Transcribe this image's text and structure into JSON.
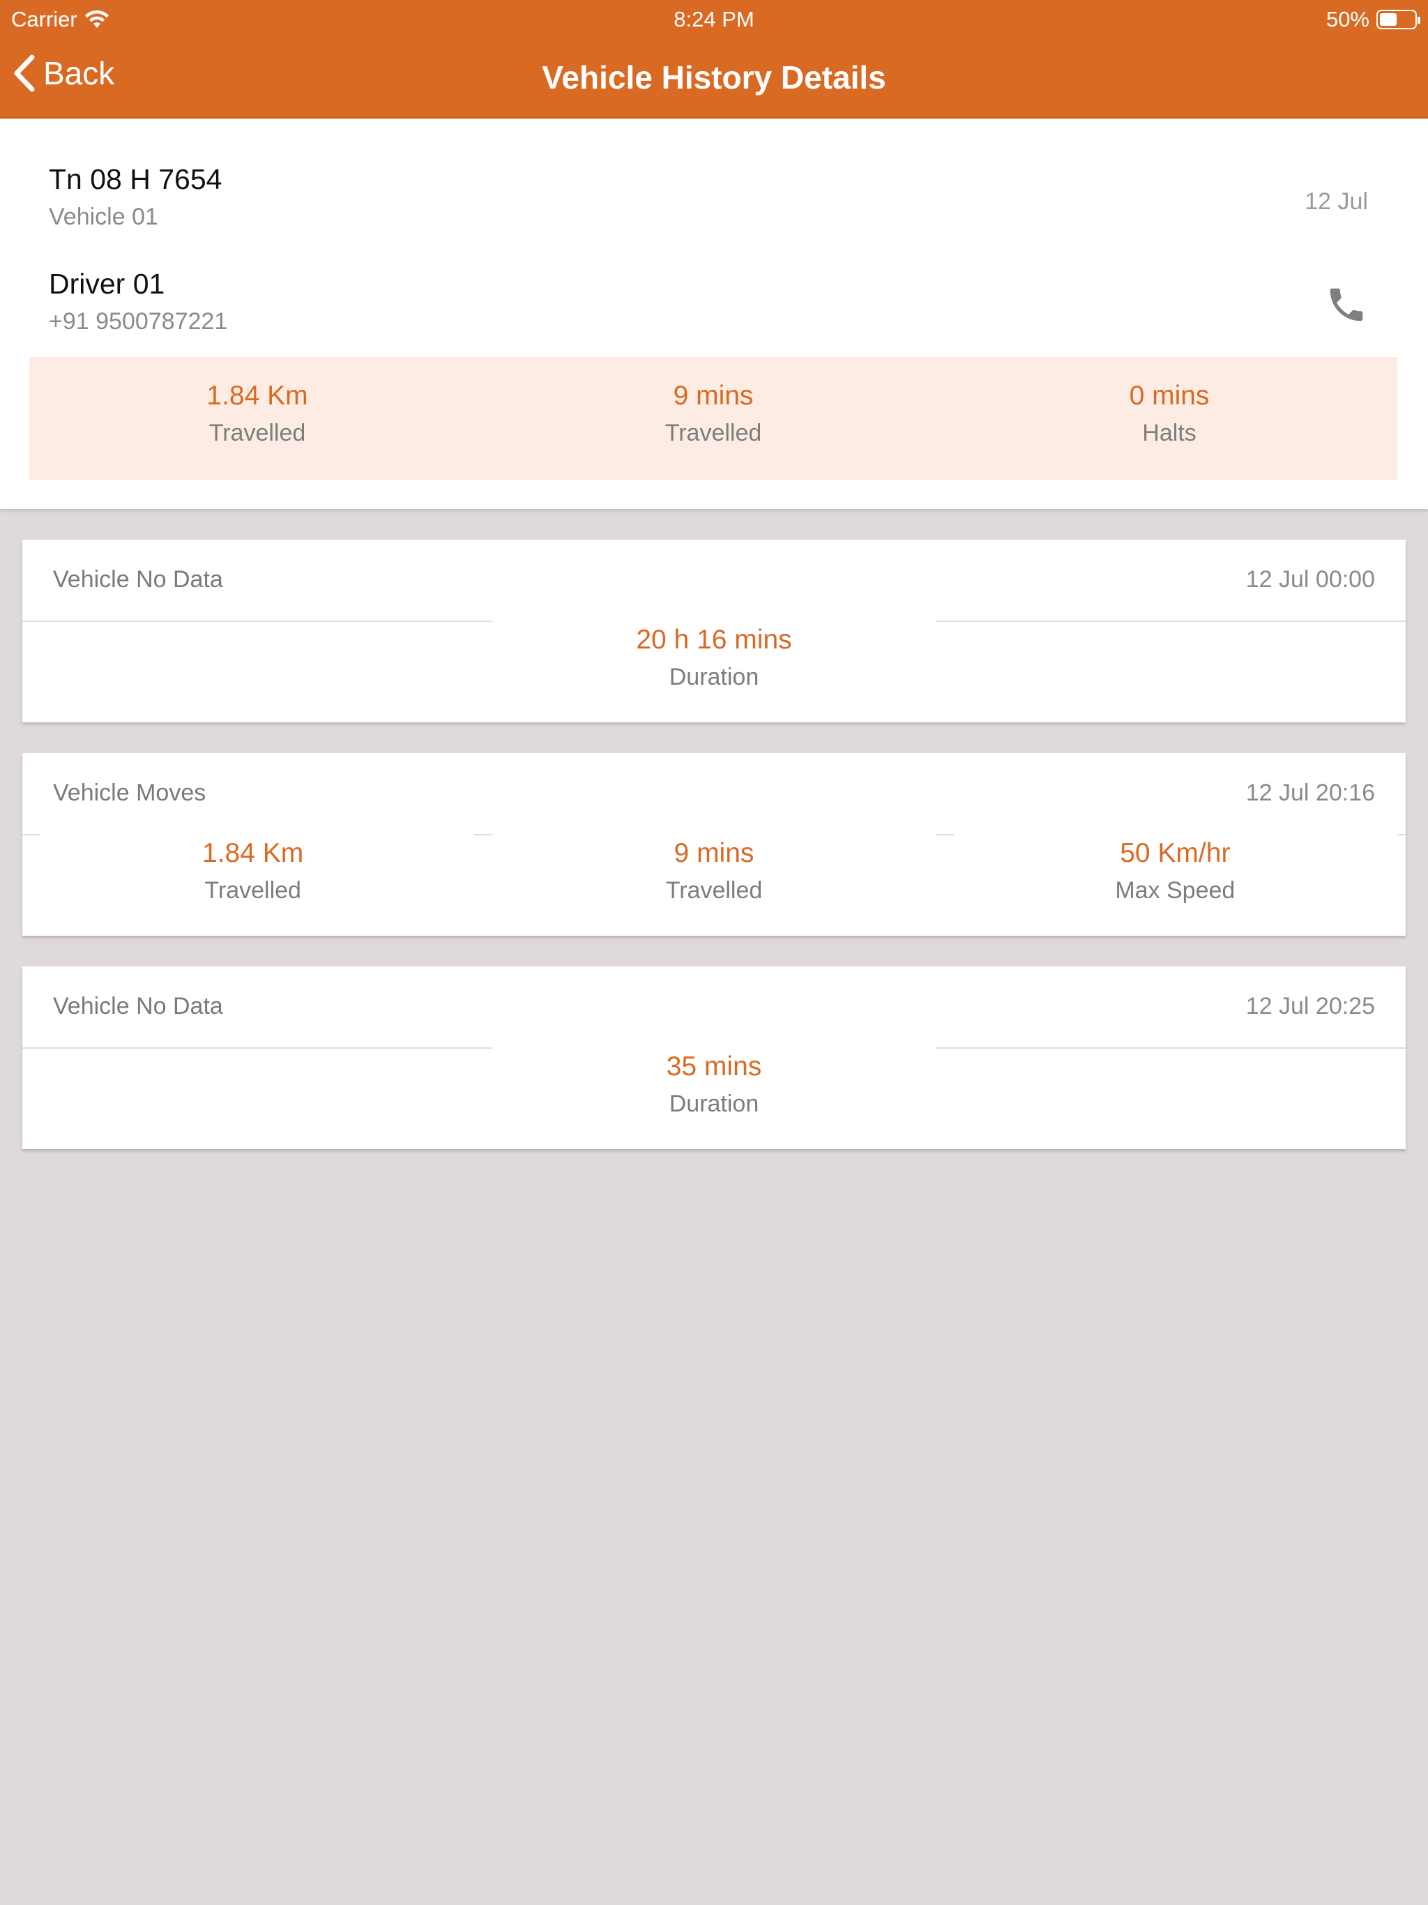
{
  "status_bar": {
    "carrier": "Carrier",
    "time": "8:24 PM",
    "battery": "50%"
  },
  "nav": {
    "back_label": "Back",
    "title": "Vehicle History Details"
  },
  "summary": {
    "vehicle_number": "Tn 08 H 7654",
    "vehicle_name": "Vehicle 01",
    "date": "12 Jul",
    "driver_name": "Driver 01",
    "driver_phone": "+91 9500787221",
    "stats": [
      {
        "value": "1.84 Km",
        "label": "Travelled"
      },
      {
        "value": "9 mins",
        "label": "Travelled"
      },
      {
        "value": "0 mins",
        "label": "Halts"
      }
    ]
  },
  "events": [
    {
      "title": "Vehicle No Data",
      "datetime": "12 Jul 00:00",
      "value": "20 h 16 mins",
      "label": "Duration"
    },
    {
      "title": "Vehicle Moves",
      "datetime": "12 Jul 20:16",
      "stats": [
        {
          "value": "1.84 Km",
          "label": "Travelled"
        },
        {
          "value": "9 mins",
          "label": "Travelled"
        },
        {
          "value": "50 Km/hr",
          "label": "Max Speed"
        }
      ]
    },
    {
      "title": "Vehicle No Data",
      "datetime": "12 Jul 20:25",
      "value": "35 mins",
      "label": "Duration"
    }
  ],
  "colors": {
    "accent": "#d96a24",
    "band": "#fdece3",
    "background": "#dfdad9"
  }
}
